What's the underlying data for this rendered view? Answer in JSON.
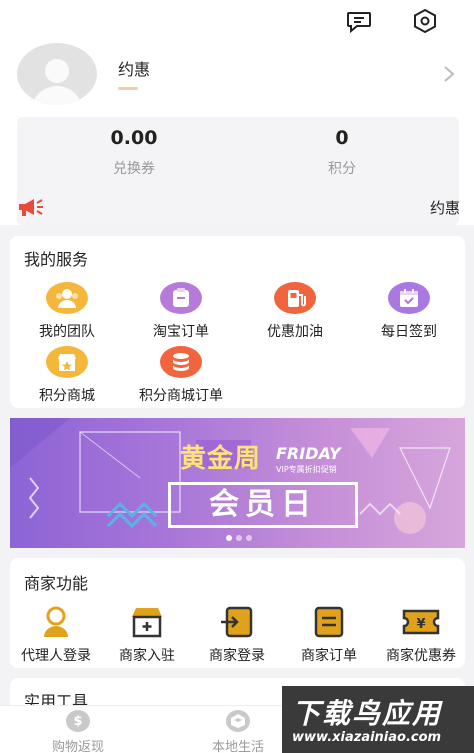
{
  "header": {
    "icons": [
      "chat-bubble-icon",
      "settings-hexagon-icon"
    ]
  },
  "profile": {
    "username": "约惠",
    "stats": [
      {
        "value": "0.00",
        "label": "兑换券"
      },
      {
        "value": "0",
        "label": "积分"
      }
    ]
  },
  "notice": {
    "text": "约惠"
  },
  "services": {
    "title": "我的服务",
    "items": [
      {
        "label": "我的团队",
        "icon": "team-icon",
        "color": "#f5b63c"
      },
      {
        "label": "淘宝订单",
        "icon": "taobao-order-icon",
        "color": "#b67bd9"
      },
      {
        "label": "优惠加油",
        "icon": "fuel-pump-icon",
        "color": "#f0653e"
      },
      {
        "label": "每日签到",
        "icon": "calendar-check-icon",
        "color": "#a978e0"
      },
      {
        "label": "积分商城",
        "icon": "points-store-icon",
        "color": "#f5b63c"
      },
      {
        "label": "积分商城订单",
        "icon": "coins-stack-icon",
        "color": "#f0653e"
      }
    ]
  },
  "banner": {
    "title": "黄金周",
    "friday": "FRIDAY",
    "subtitle": "VIP专属折扣促销",
    "main": "会员日"
  },
  "merchant": {
    "title": "商家功能",
    "items": [
      {
        "label": "代理人登录",
        "icon": "agent-user-icon"
      },
      {
        "label": "商家入驻",
        "icon": "shop-join-icon"
      },
      {
        "label": "商家登录",
        "icon": "merchant-login-icon"
      },
      {
        "label": "商家订单",
        "icon": "merchant-order-icon"
      },
      {
        "label": "商家优惠券",
        "icon": "coupon-yen-icon"
      }
    ],
    "accent": "#e0a21a"
  },
  "tools": {
    "title": "实用工具"
  },
  "bottom_nav": {
    "items": [
      {
        "label": "购物返现",
        "icon": "dollar-coin-icon"
      },
      {
        "label": "本地生活",
        "icon": "local-life-icon"
      }
    ]
  },
  "watermark": {
    "title": "下载鸟应用",
    "url": "www.xiazainiao.com"
  }
}
